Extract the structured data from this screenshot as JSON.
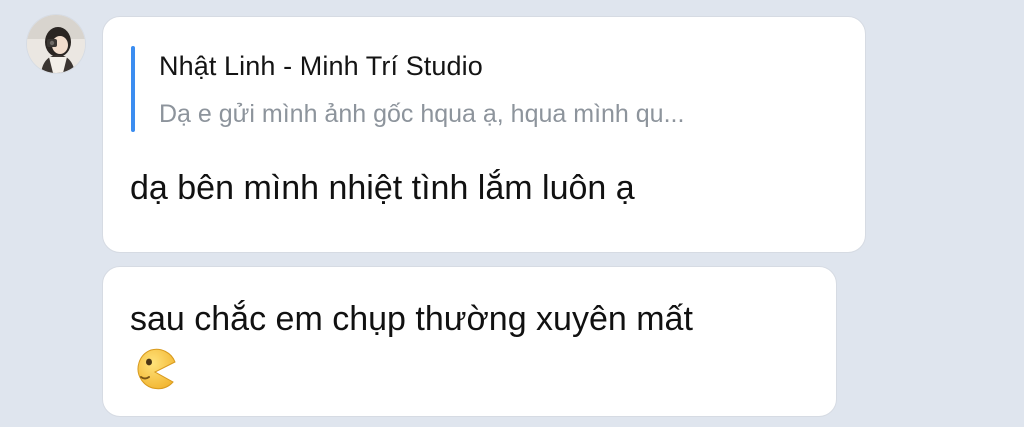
{
  "conversation": {
    "avatar_icon": "user-avatar",
    "messages": [
      {
        "reply": {
          "sender": "Nhật Linh - Minh Trí Studio",
          "preview": "Dạ e gửi mình ảnh gốc hqua ạ, hqua mình qu..."
        },
        "text": "dạ bên mình nhiệt tình lắm luôn ạ"
      },
      {
        "text": "sau chắc em chụp thường xuyên mất",
        "emoji": "pacman-smiley-icon"
      }
    ]
  },
  "colors": {
    "background": "#dfe5ee",
    "bubble": "#ffffff",
    "quote_bar": "#3b8df0",
    "preview_text": "#8d949c"
  }
}
